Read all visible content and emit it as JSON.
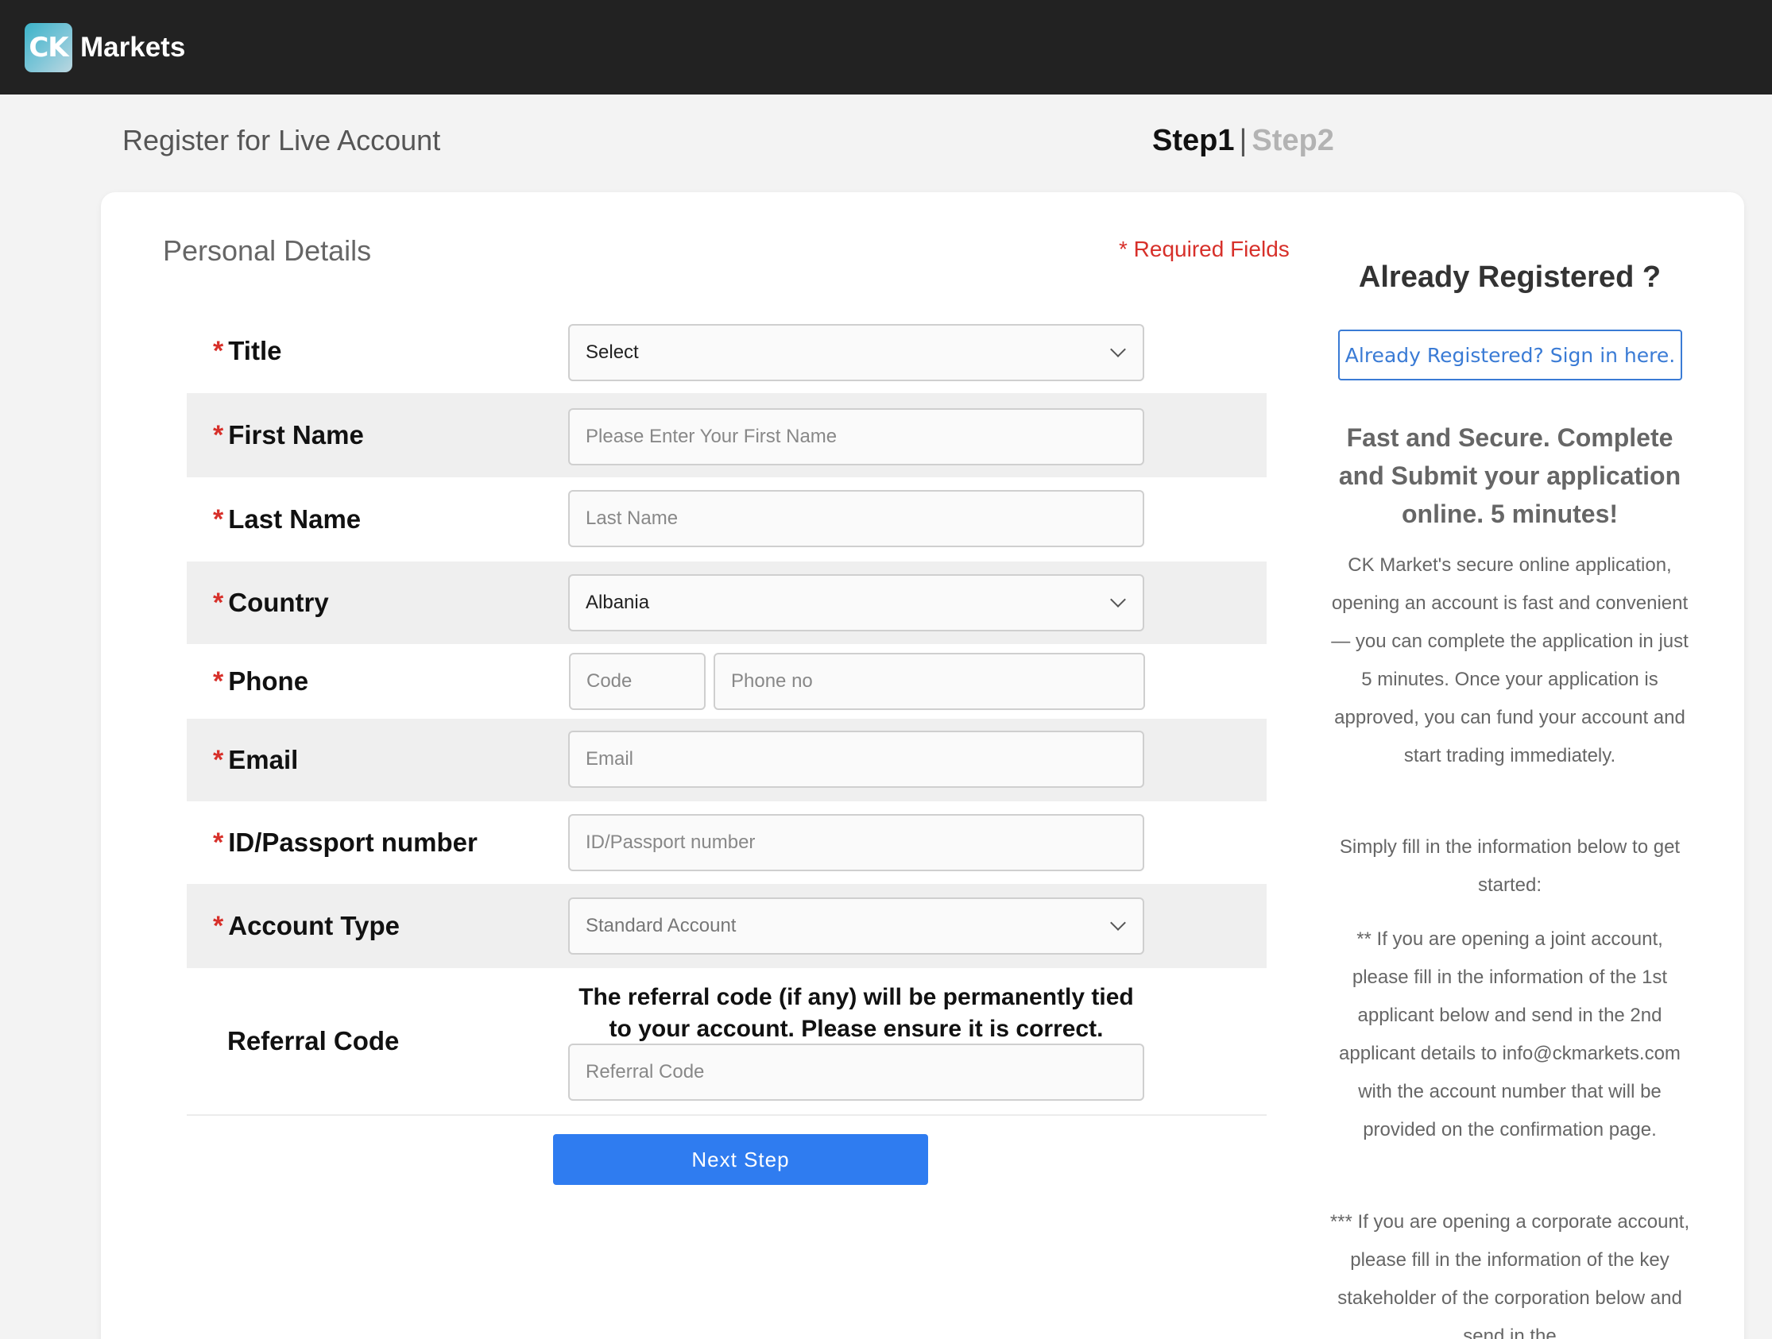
{
  "brand": {
    "badge": "CK",
    "name": "Markets"
  },
  "header": {
    "title": "Register for Live Account",
    "step1": "Step1",
    "separator": "|",
    "step2": "Step2"
  },
  "form": {
    "section_title": "Personal Details",
    "required_note": "* Required Fields",
    "star": "*",
    "title": {
      "label": "Title",
      "value": "Select"
    },
    "first_name": {
      "label": "First Name",
      "placeholder": "Please Enter Your First Name"
    },
    "last_name": {
      "label": "Last Name",
      "placeholder": "Last Name"
    },
    "country": {
      "label": "Country",
      "value": "Albania"
    },
    "phone": {
      "label": "Phone",
      "code_placeholder": "Code",
      "number_placeholder": "Phone no"
    },
    "email": {
      "label": "Email",
      "placeholder": "Email"
    },
    "id_passport": {
      "label": "ID/Passport number",
      "placeholder": "ID/Passport number"
    },
    "account_type": {
      "label": "Account Type",
      "value": "Standard Account"
    },
    "referral": {
      "label": "Referral Code",
      "note": "The referral code (if any) will be permanently tied to your account. Please ensure it is correct.",
      "placeholder": "Referral Code"
    },
    "next_button": "Next Step"
  },
  "side": {
    "already_title": "Already Registered ?",
    "signin_link": "Already Registered? Sign in here.",
    "fast_title": "Fast and Secure. Complete and Submit your application online. 5 minutes!",
    "para1": "CK Market's secure online application, opening an account is fast and convenient — you can complete the application in just 5 minutes. Once your application is approved, you can fund your account and start trading immediately.",
    "para2": "Simply fill in the information below to get started:",
    "para3": "** If you are opening a joint account, please fill in the information of the 1st applicant below and send in the 2nd applicant details to info@ckmarkets.com with the account number that will be provided on the confirmation page.",
    "para4": "*** If you are opening a corporate account, please fill in the information of the key stakeholder of the corporation below and send in the"
  },
  "colors": {
    "accent": "#2f7cf0",
    "required": "#d7302a",
    "topbar": "#222222",
    "link": "#3a7bd5"
  }
}
